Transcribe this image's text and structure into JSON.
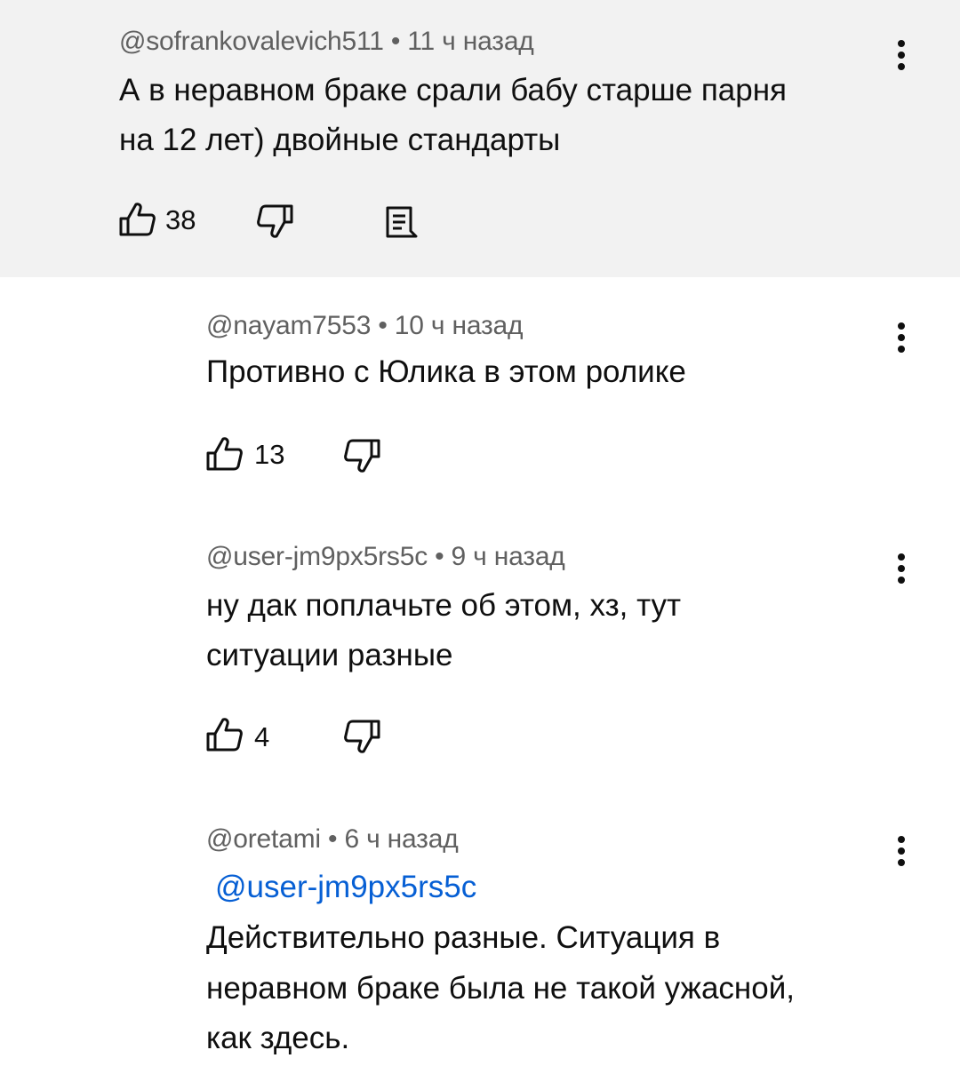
{
  "comments": [
    {
      "meta": "@sofrankovalevich511 • 11 ч назад",
      "lines": [
        "А в неравном браке срали бабу старше парня",
        "на 12 лет) двойные стандарты"
      ],
      "likes": "38",
      "icons": [
        "thumb-up-icon",
        "thumb-down-icon",
        "reply-icon",
        "more-vert-icon"
      ]
    },
    {
      "meta": "@nayam7553 • 10 ч назад",
      "lines": [
        "Противно с Юлика в этом ролике"
      ],
      "likes": "13"
    },
    {
      "meta": "@user-jm9px5rs5c • 9 ч назад",
      "lines": [
        "ну дак поплачьте об этом, хз, тут",
        "ситуации разные"
      ],
      "likes": "4"
    },
    {
      "meta": "@oretami • 6 ч назад",
      "mention": "@user-jm9px5rs5c",
      "lines": [
        "Действительно разные. Ситуация в",
        "неравном браке была не такой ужасной,",
        "как здесь."
      ]
    }
  ],
  "colors": {
    "parent_background": "#f2f2f2",
    "meta_text": "#606060",
    "body_text": "#0f0f0f",
    "mention_link": "#065fd4"
  }
}
